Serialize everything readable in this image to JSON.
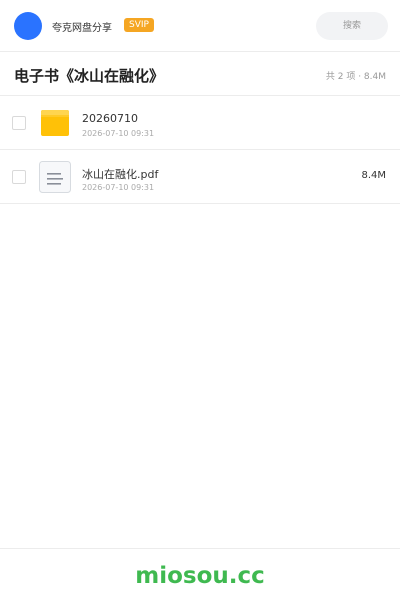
{
  "header": {
    "user_name": "夸克网盘分享",
    "badge": "SVIP",
    "search_placeholder": "搜索"
  },
  "title_row": {
    "title": "电子书《冰山在融化》",
    "summary": "共 2 项 · 8.4M"
  },
  "files": [
    {
      "name": "20260710",
      "date": "2026-07-10 09:31",
      "size": "",
      "icon": "folder-icon"
    },
    {
      "name": "冰山在融化.pdf",
      "date": "2026-07-10 09:31",
      "size": "8.4M",
      "icon": "document-icon"
    }
  ],
  "footer": {
    "brand": "miosou.cc"
  },
  "colors": {
    "accent_blue": "#2a73ff",
    "svip_orange": "#f5a623",
    "folder_yellow": "#ffc107",
    "brand_green": "#3fb950"
  }
}
